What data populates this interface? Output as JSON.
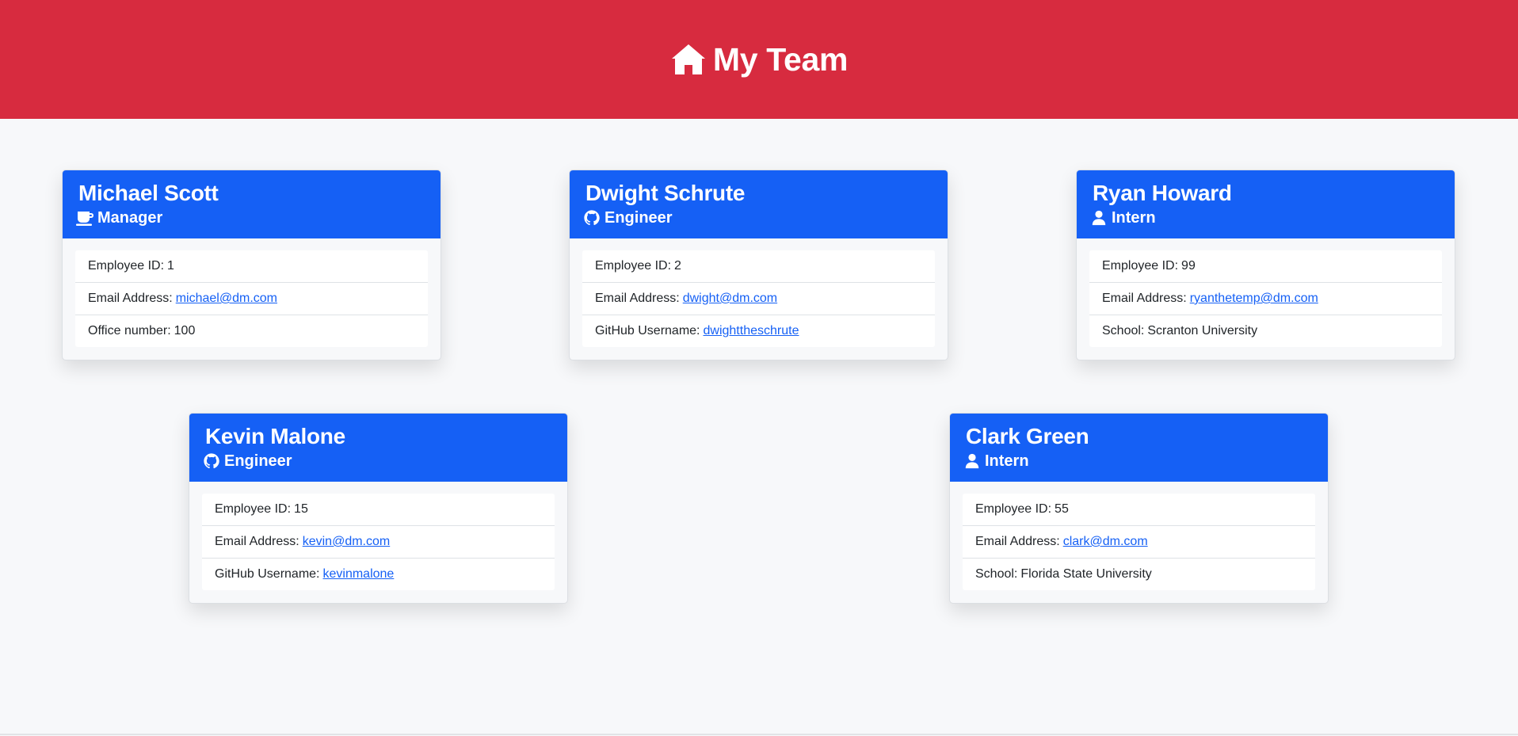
{
  "header": {
    "title": "My Team",
    "icon": "home-icon",
    "background": "#d72b3f"
  },
  "colors": {
    "card_header": "#1560f5",
    "link": "#1560f5"
  },
  "cards": [
    {
      "name": "Michael Scott",
      "role": "Manager",
      "role_icon": "coffee-icon",
      "rows": [
        {
          "label": "Employee ID:",
          "value": "1"
        },
        {
          "label": "Email Address:",
          "value": "michael@dm.com",
          "link": true
        },
        {
          "label": "Office number:",
          "value": "100"
        }
      ]
    },
    {
      "name": "Dwight Schrute",
      "role": "Engineer",
      "role_icon": "github-icon",
      "rows": [
        {
          "label": "Employee ID:",
          "value": "2"
        },
        {
          "label": "Email Address:",
          "value": "dwight@dm.com",
          "link": true
        },
        {
          "label": "GitHub Username:",
          "value": "dwighttheschrute",
          "link": true
        }
      ]
    },
    {
      "name": "Ryan Howard",
      "role": "Intern",
      "role_icon": "user-icon",
      "rows": [
        {
          "label": "Employee ID:",
          "value": "99"
        },
        {
          "label": "Email Address:",
          "value": "ryanthetemp@dm.com",
          "link": true
        },
        {
          "label": "School:",
          "value": "Scranton University"
        }
      ]
    },
    {
      "name": "Kevin Malone",
      "role": "Engineer",
      "role_icon": "github-icon",
      "rows": [
        {
          "label": "Employee ID:",
          "value": "15"
        },
        {
          "label": "Email Address:",
          "value": "kevin@dm.com",
          "link": true
        },
        {
          "label": "GitHub Username:",
          "value": "kevinmalone",
          "link": true
        }
      ]
    },
    {
      "name": "Clark Green",
      "role": "Intern",
      "role_icon": "user-icon",
      "rows": [
        {
          "label": "Employee ID:",
          "value": "55"
        },
        {
          "label": "Email Address:",
          "value": "clark@dm.com",
          "link": true
        },
        {
          "label": "School:",
          "value": "Florida State University"
        }
      ]
    }
  ]
}
